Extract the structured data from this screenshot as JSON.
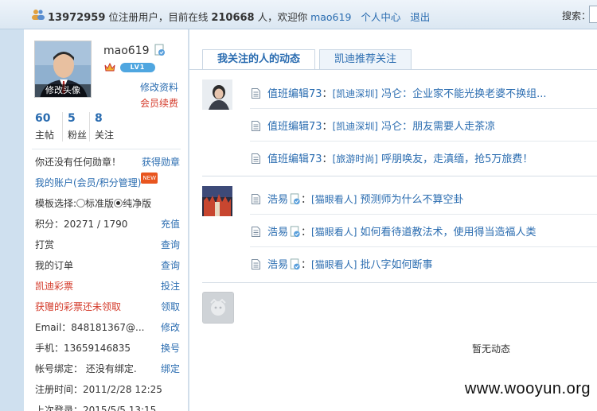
{
  "topbar": {
    "registered_count": "13972959",
    "registered_suffix": " 位注册用户，目前在线 ",
    "online_count": "210668",
    "online_suffix": " 人，欢迎你 ",
    "username": "mao619",
    "user_center": "个人中心",
    "logout": "退出",
    "search_label": "搜索："
  },
  "profile": {
    "avatar_edit_label": "修改头像",
    "username": "mao619",
    "level_badge": "LV1",
    "edit_profile": "修改资料",
    "renew_member": "会员续费",
    "counts": [
      {
        "num": "60",
        "label": "主帖"
      },
      {
        "num": "5",
        "label": "粉丝"
      },
      {
        "num": "8",
        "label": "关注"
      }
    ]
  },
  "side_rows": [
    {
      "left": "你还没有任何勋章！",
      "right": "获得勋章",
      "left_color": "normal"
    },
    {
      "left": "我的账户(会员/积分管理)",
      "right": "",
      "left_color": "blue",
      "badge": "NEW"
    },
    {
      "left": "模板选择:",
      "right": "",
      "left_color": "normal",
      "options": [
        "标准版",
        "纯净版"
      ]
    },
    {
      "left": "积分：20271 / 1790",
      "right": "充值",
      "left_color": "normal"
    },
    {
      "left": "打赏",
      "right": "查询",
      "left_color": "normal"
    },
    {
      "left": "我的订单",
      "right": "查询",
      "left_color": "normal"
    },
    {
      "left": "凯迪彩票",
      "right": "投注",
      "left_color": "red"
    },
    {
      "left": "获赠的彩票还未领取",
      "right": "领取",
      "left_color": "red"
    },
    {
      "left": "Email：848181367@...",
      "right": "修改",
      "left_color": "normal"
    },
    {
      "left": "手机：13659146835",
      "right": "换号",
      "left_color": "normal"
    },
    {
      "left": "帐号绑定： 还没有绑定.",
      "right": "绑定",
      "left_color": "normal"
    },
    {
      "left": "注册时间：2011/2/28 12:25",
      "right": "",
      "left_color": "normal"
    },
    {
      "left": "上次登录：2015/5/5 13:15",
      "right": "",
      "left_color": "normal"
    }
  ],
  "tabs": [
    "我关注的人的动态",
    "凯迪推荐关注"
  ],
  "feed": {
    "group1": [
      {
        "author": "值班编辑73",
        "category": "[凯迪深圳]",
        "title": "冯仑：企业家不能光换老婆不换组..."
      },
      {
        "author": "值班编辑73",
        "category": "[凯迪深圳]",
        "title": "冯仑：朋友需要人走茶凉"
      },
      {
        "author": "值班编辑73",
        "category": "[旅游时尚]",
        "title": "呼朋唤友，走滇缅，抢5万旅费！"
      }
    ],
    "group2": [
      {
        "author": "浩易",
        "category": "[猫眼看人]",
        "title": "预测师为什么不算空卦"
      },
      {
        "author": "浩易",
        "category": "[猫眼看人]",
        "title": "如何看待道教法术，使用得当造福人类"
      },
      {
        "author": "浩易",
        "category": "[猫眼看人]",
        "title": "批八字如何断事"
      }
    ],
    "empty_text": "暂无动态"
  },
  "watermark": "www.wooyun.org"
}
